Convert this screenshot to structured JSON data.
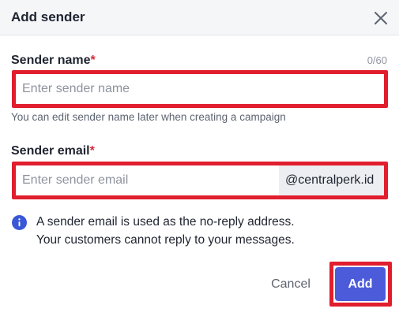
{
  "dialog": {
    "title": "Add sender",
    "close_icon": "close-icon"
  },
  "sender_name": {
    "label": "Sender name",
    "required_mark": "*",
    "counter": "0/60",
    "value": "",
    "placeholder": "Enter sender name",
    "helper": "You can edit sender name later when creating a campaign"
  },
  "sender_email": {
    "label": "Sender email",
    "required_mark": "*",
    "value": "",
    "placeholder": "Enter sender email",
    "domain": "@centralperk.id"
  },
  "info": {
    "icon": "info-icon",
    "line1": "A sender email is used as the no-reply address.",
    "line2": "Your customers cannot reply to your messages."
  },
  "actions": {
    "cancel_label": "Cancel",
    "add_label": "Add"
  },
  "colors": {
    "primary": "#4b5bd9",
    "required": "#d42a3a",
    "highlight": "#e01e2e",
    "info": "#3a57d6"
  }
}
